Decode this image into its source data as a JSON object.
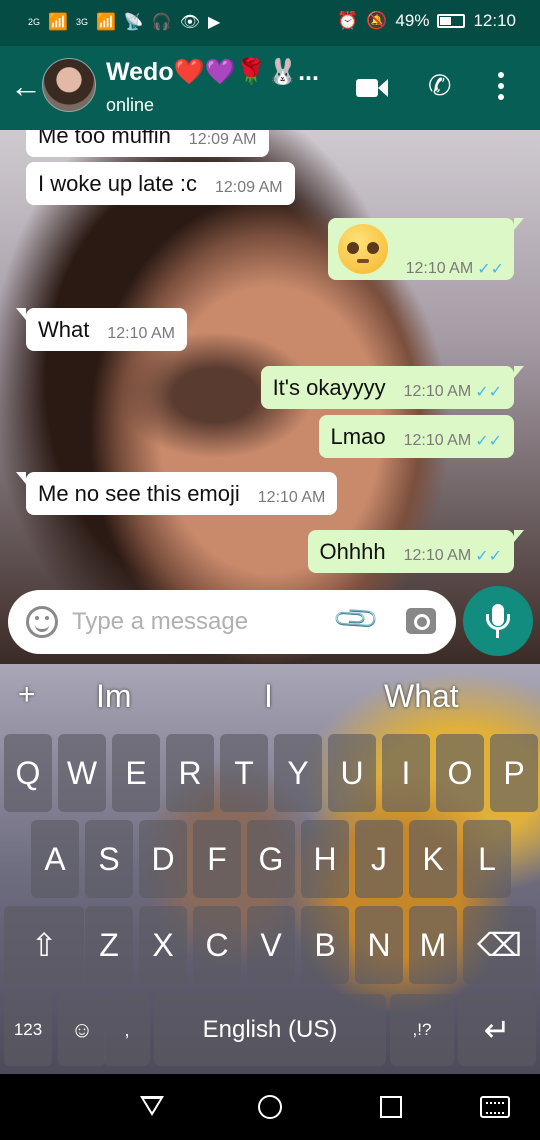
{
  "status_bar": {
    "battery_percent": "49%",
    "time": "12:10",
    "network_left": "2G",
    "network_right": "3G"
  },
  "header": {
    "contact_name": "Wedo❤️💜🌹🐰...",
    "contact_status": "online"
  },
  "messages": [
    {
      "direction": "in",
      "text": "Me too muffin",
      "time": "12:09 AM"
    },
    {
      "direction": "in",
      "text": "I woke up late :c",
      "time": "12:09 AM"
    },
    {
      "direction": "out",
      "text": "🥺",
      "time": "12:10 AM",
      "read": true
    },
    {
      "direction": "in",
      "text": "What",
      "time": "12:10 AM"
    },
    {
      "direction": "out",
      "text": "It's okayyyy",
      "time": "12:10 AM",
      "read": true
    },
    {
      "direction": "out",
      "text": "Lmao",
      "time": "12:10 AM",
      "read": true
    },
    {
      "direction": "in",
      "text": "Me no see this emoji",
      "time": "12:10 AM"
    },
    {
      "direction": "out",
      "text": "Ohhhh",
      "time": "12:10 AM",
      "read": true
    }
  ],
  "composer": {
    "placeholder": "Type a message"
  },
  "keyboard": {
    "suggestions": [
      "Im",
      "I",
      "What"
    ],
    "suggest_plus": "+",
    "row1": [
      "Q",
      "W",
      "E",
      "R",
      "T",
      "Y",
      "U",
      "I",
      "O",
      "P"
    ],
    "row2": [
      "A",
      "S",
      "D",
      "F",
      "G",
      "H",
      "J",
      "K",
      "L"
    ],
    "row3": [
      "Z",
      "X",
      "C",
      "V",
      "B",
      "N",
      "M"
    ],
    "numeric_label": "123",
    "space_label": "English (US)",
    "punct_label": ",!?",
    "comma_label": ","
  },
  "icons": {
    "shift": "⇧",
    "backspace": "⌫",
    "enter": "↵",
    "emoji_key": "☺",
    "mic_key": "🎤",
    "read_ticks": "✓✓",
    "back_arrow": "←",
    "call": "✆",
    "attach": "📎",
    "status_left": [
      "📶",
      "📶",
      "📡",
      "🎧",
      "👁",
      "▶"
    ],
    "status_right": [
      "⏰",
      "🔕"
    ]
  },
  "colors": {
    "header": "#075e54",
    "status": "#054d44",
    "outgoing": "#dcf8c6",
    "incoming": "#ffffff",
    "read_tick": "#4fb6ec",
    "mic": "#128c7e"
  }
}
